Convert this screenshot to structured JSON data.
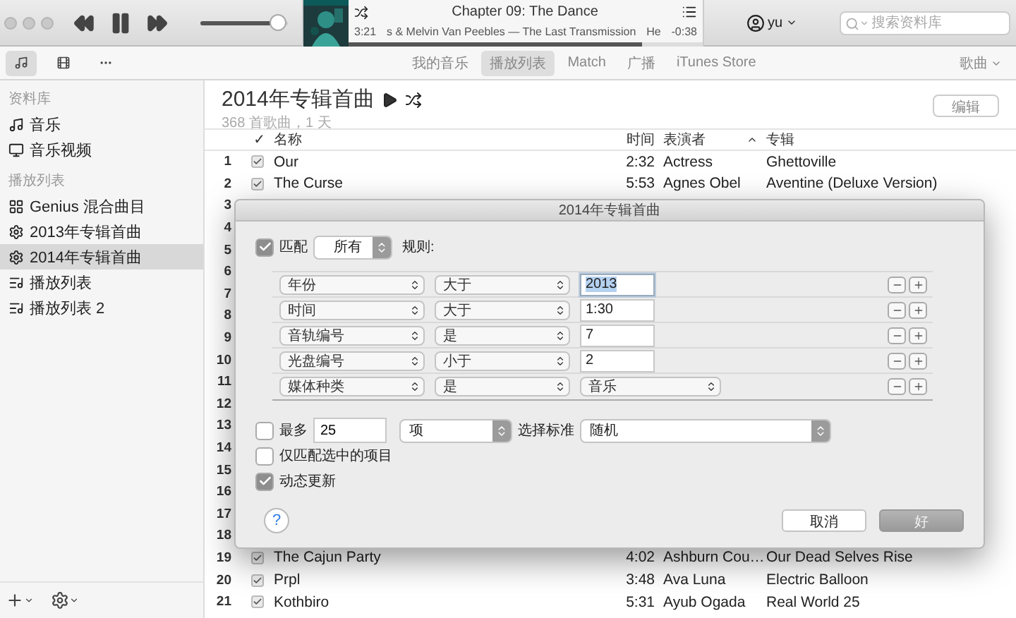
{
  "player": {
    "volume": {
      "level": 0.92
    },
    "now_playing": {
      "title": "Chapter 09: The Dance",
      "elapsed": "3:21",
      "subtitle": "s & Melvin Van Peebles — The Last Transmission",
      "next_fragment": "He",
      "remaining": "-0:38",
      "progress": {
        "level": 0.83
      }
    },
    "user": "yu",
    "search": {
      "placeholder": "搜索资料库"
    }
  },
  "nav": {
    "view_buttons": [
      {
        "kind": "music",
        "selected": true
      },
      {
        "kind": "film",
        "selected": false
      },
      {
        "kind": "more",
        "selected": false
      }
    ],
    "tabs": [
      {
        "label": "我的音乐",
        "selected": false
      },
      {
        "label": "播放列表",
        "selected": true
      },
      {
        "label": "Match",
        "selected": false
      },
      {
        "label": "广播",
        "selected": false
      },
      {
        "label": "iTunes Store",
        "selected": false
      }
    ],
    "view_menu": "歌曲"
  },
  "sidebar": {
    "sections": [
      {
        "heading": "资料库",
        "items": [
          {
            "label": "音乐",
            "kind": "music",
            "selected": false
          },
          {
            "label": "音乐视频",
            "kind": "video",
            "selected": false
          }
        ]
      },
      {
        "heading": "播放列表",
        "items": [
          {
            "label": "Genius 混合曲目",
            "kind": "genius",
            "selected": false
          },
          {
            "label": "2013年专辑首曲",
            "kind": "smart",
            "selected": false
          },
          {
            "label": "2014年专辑首曲",
            "kind": "smart",
            "selected": true
          },
          {
            "label": "播放列表",
            "kind": "playlist",
            "selected": false
          },
          {
            "label": "播放列表 2",
            "kind": "playlist",
            "selected": false
          }
        ]
      }
    ]
  },
  "playlist": {
    "title": "2014年专辑首曲",
    "subtitle": "368 首歌曲，1 天",
    "edit_button": "编辑"
  },
  "table": {
    "columns": [
      {
        "label": "✓",
        "sorted": false
      },
      {
        "label": "名称",
        "sorted": false
      },
      {
        "label": "时间",
        "sorted": false
      },
      {
        "label": "表演者",
        "sorted": true
      },
      {
        "label": "专辑",
        "sorted": false
      }
    ],
    "rows": [
      {
        "number": "1",
        "checked": true,
        "name": "Our",
        "time": "2:32",
        "artist": "Actress",
        "album": "Ghettoville"
      },
      {
        "number": "2",
        "checked": true,
        "name": "The Curse",
        "time": "5:53",
        "artist": "Agnes Obel",
        "album": "Aventine (Deluxe Version)"
      },
      {
        "number": "3"
      },
      {
        "number": "4"
      },
      {
        "number": "5"
      },
      {
        "number": "6"
      },
      {
        "number": "7"
      },
      {
        "number": "8"
      },
      {
        "number": "9"
      },
      {
        "number": "10"
      },
      {
        "number": "11"
      },
      {
        "number": "12"
      },
      {
        "number": "13"
      },
      {
        "number": "14"
      },
      {
        "number": "15"
      },
      {
        "number": "16"
      },
      {
        "number": "17"
      },
      {
        "number": "18"
      },
      {
        "number": "19",
        "checked": true,
        "name": "The Cajun Party",
        "time": "4:02",
        "artist": "Ashburn Cou…",
        "album": "Our Dead Selves Rise"
      },
      {
        "number": "20",
        "checked": true,
        "name": "Prpl",
        "time": "3:48",
        "artist": "Ava Luna",
        "album": "Electric Balloon"
      },
      {
        "number": "21",
        "checked": true,
        "name": "Kothbiro",
        "time": "5:31",
        "artist": "Ayub Ogada",
        "album": "Real World 25"
      }
    ]
  },
  "dialog": {
    "title": "2014年专辑首曲",
    "match": {
      "checked": true,
      "label": "匹配",
      "mode": "所有",
      "suffix": "规则:"
    },
    "rules": [
      {
        "field": "年份",
        "operator": "大于",
        "value": "2013",
        "kind": "input",
        "text_selected": true
      },
      {
        "field": "时间",
        "operator": "大于",
        "value": "1:30",
        "kind": "input",
        "text_selected": false
      },
      {
        "field": "音轨编号",
        "operator": "是",
        "value": "7",
        "kind": "input",
        "text_selected": false
      },
      {
        "field": "光盘编号",
        "operator": "小于",
        "value": "2",
        "kind": "input",
        "text_selected": false
      },
      {
        "field": "媒体种类",
        "operator": "是",
        "value": "音乐",
        "kind": "popup"
      }
    ],
    "limit": {
      "checked": false,
      "label": "最多",
      "count": "25",
      "unit": "项",
      "criterion_label": "选择标准",
      "criterion": "随机"
    },
    "options": [
      {
        "label": "仅匹配选中的项目",
        "checked": false
      },
      {
        "label": "动态更新",
        "checked": true
      }
    ],
    "help": "?",
    "buttons": [
      {
        "label": "取消",
        "kind": "normal"
      },
      {
        "label": "好",
        "kind": "default"
      }
    ]
  }
}
